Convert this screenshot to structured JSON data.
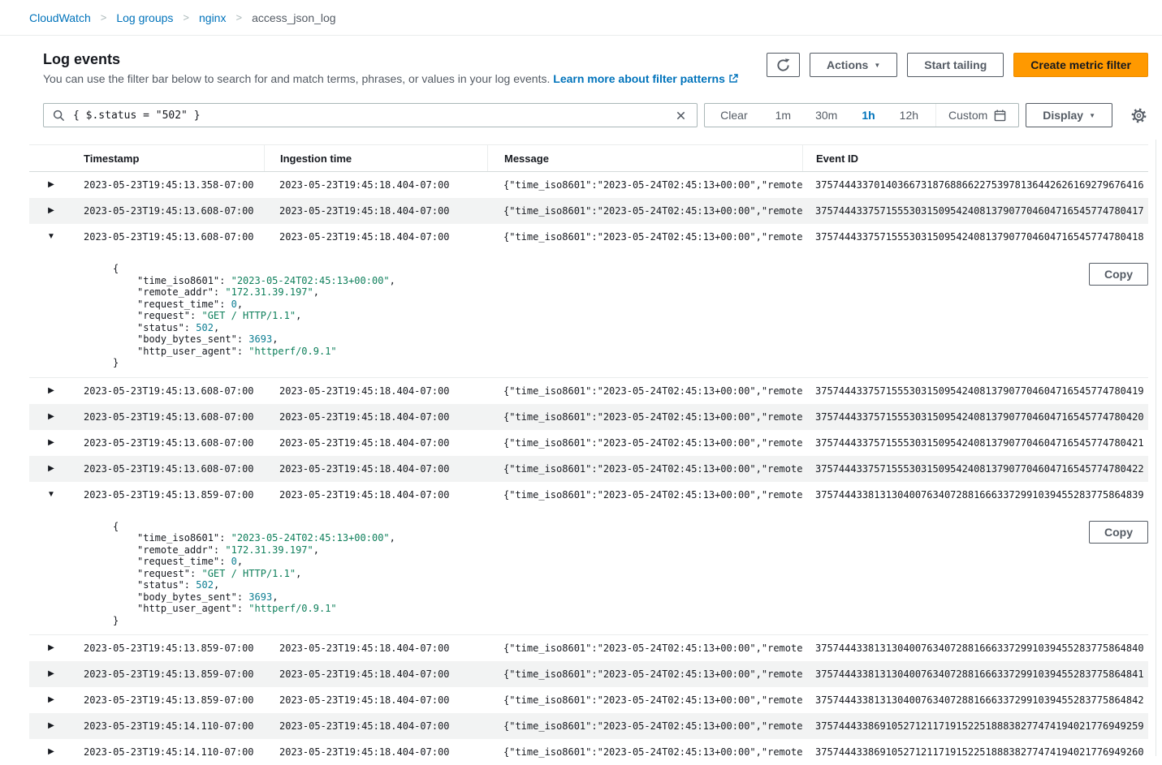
{
  "icons": {
    "breadcrumb_separator": ">",
    "caret": "▼",
    "expand_collapsed": "▶",
    "expand_expanded": "▼"
  },
  "colors": {
    "link_blue": "#0073bb",
    "primary_button_orange": "#ff9900",
    "selected_range_blue": "#0073bb",
    "row_stripe": "#f2f3f3"
  },
  "breadcrumb": {
    "items": [
      {
        "label": "CloudWatch"
      },
      {
        "label": "Log groups"
      },
      {
        "label": "nginx"
      },
      {
        "label": "access_json_log"
      }
    ]
  },
  "header": {
    "title": "Log events",
    "description": "You can use the filter bar below to search for and match terms, phrases, or values in your log events.",
    "learn_more_label": "Learn more about filter patterns",
    "actions_label": "Actions",
    "start_tailing_label": "Start tailing",
    "create_metric_filter_label": "Create metric filter"
  },
  "filter": {
    "value": "{ $.status = \"502\" }",
    "clear_label": "Clear",
    "ranges": [
      "1m",
      "30m",
      "1h",
      "12h"
    ],
    "selected_range": "1h",
    "custom_label": "Custom",
    "display_label": "Display"
  },
  "table": {
    "columns": [
      "Timestamp",
      "Ingestion time",
      "Message",
      "Event ID"
    ],
    "ingestion_time": "2023-05-23T19:45:18.404-07:00",
    "message_preview": "{\"time_iso8601\":\"2023-05-24T02:45:13+00:00\",\"remote_…",
    "copy_label": "Copy",
    "rows": [
      {
        "timestamp": "2023-05-23T19:45:13.358-07:00",
        "event_id": "37574443370140366731876886622753978136442626169279676416",
        "expanded": false,
        "shaded": false
      },
      {
        "timestamp": "2023-05-23T19:45:13.608-07:00",
        "event_id": "37574443375715553031509542408137907704604716545774780417",
        "expanded": false,
        "shaded": true
      },
      {
        "timestamp": "2023-05-23T19:45:13.608-07:00",
        "event_id": "37574443375715553031509542408137907704604716545774780418",
        "expanded": true,
        "shaded": false
      },
      {
        "timestamp": "2023-05-23T19:45:13.608-07:00",
        "event_id": "37574443375715553031509542408137907704604716545774780419",
        "expanded": false,
        "shaded": false
      },
      {
        "timestamp": "2023-05-23T19:45:13.608-07:00",
        "event_id": "37574443375715553031509542408137907704604716545774780420",
        "expanded": false,
        "shaded": true
      },
      {
        "timestamp": "2023-05-23T19:45:13.608-07:00",
        "event_id": "37574443375715553031509542408137907704604716545774780421",
        "expanded": false,
        "shaded": false
      },
      {
        "timestamp": "2023-05-23T19:45:13.608-07:00",
        "event_id": "37574443375715553031509542408137907704604716545774780422",
        "expanded": false,
        "shaded": true
      },
      {
        "timestamp": "2023-05-23T19:45:13.859-07:00",
        "event_id": "37574443381313040076340728816663372991039455283775864839",
        "expanded": true,
        "shaded": false
      },
      {
        "timestamp": "2023-05-23T19:45:13.859-07:00",
        "event_id": "37574443381313040076340728816663372991039455283775864840",
        "expanded": false,
        "shaded": false
      },
      {
        "timestamp": "2023-05-23T19:45:13.859-07:00",
        "event_id": "37574443381313040076340728816663372991039455283775864841",
        "expanded": false,
        "shaded": true
      },
      {
        "timestamp": "2023-05-23T19:45:13.859-07:00",
        "event_id": "37574443381313040076340728816663372991039455283775864842",
        "expanded": false,
        "shaded": false
      },
      {
        "timestamp": "2023-05-23T19:45:14.110-07:00",
        "event_id": "37574443386910527121171915225188838277474194021776949259",
        "expanded": false,
        "shaded": true
      },
      {
        "timestamp": "2023-05-23T19:45:14.110-07:00",
        "event_id": "37574443386910527121171915225188838277474194021776949260",
        "expanded": false,
        "shaded": false
      }
    ]
  },
  "expanded_json": {
    "open": "{",
    "close": "}",
    "fields": [
      {
        "key": "time_iso8601",
        "value": "\"2023-05-24T02:45:13+00:00\"",
        "type": "string"
      },
      {
        "key": "remote_addr",
        "value": "\"172.31.39.197\"",
        "type": "string"
      },
      {
        "key": "request_time",
        "value": "0",
        "type": "number"
      },
      {
        "key": "request",
        "value": "\"GET / HTTP/1.1\"",
        "type": "string"
      },
      {
        "key": "status",
        "value": "502",
        "type": "number"
      },
      {
        "key": "body_bytes_sent",
        "value": "3693",
        "type": "number"
      },
      {
        "key": "http_user_agent",
        "value": "\"httperf/0.9.1\"",
        "type": "string"
      }
    ]
  }
}
